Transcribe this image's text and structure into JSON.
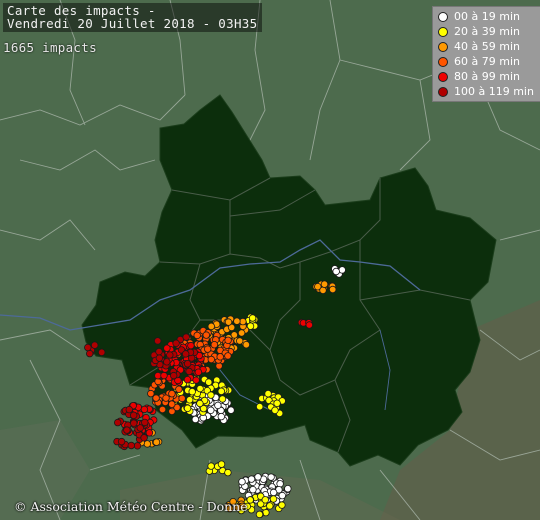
{
  "title": {
    "line1": "Carte des impacts -",
    "line2": "Vendredi 20 Juillet 2018 - 03H35"
  },
  "impacts_count": "1665 impacts",
  "legend": [
    {
      "label": "00 à 19 min",
      "color": "#ffffff"
    },
    {
      "label": "20 à 39 min",
      "color": "#ffff00"
    },
    {
      "label": "40 à 59 min",
      "color": "#ff9900"
    },
    {
      "label": "60 à 79 min",
      "color": "#ff5500"
    },
    {
      "label": "80 à 99 min",
      "color": "#ee0000"
    },
    {
      "label": "100 à 119 min",
      "color": "#b00000"
    }
  ],
  "copyright": "© Association Météo Centre - Donne",
  "colors": {
    "region": "#0c2e0c",
    "land": "#4f6c4f",
    "border": "#aeb9ae",
    "river": "#4d6a99"
  }
}
